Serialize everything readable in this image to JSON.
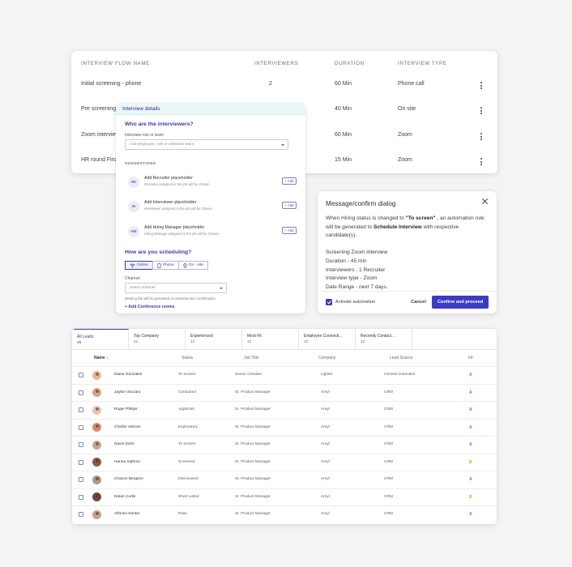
{
  "flow_table": {
    "headers": {
      "name": "INTERVIEW FLOW NAME",
      "interviewers": "INTERVIEWERS",
      "duration": "DURATION",
      "type": "INTERVIEW TYPE"
    },
    "rows": [
      {
        "name": "Initial screening - phone",
        "interviewers": "2",
        "duration": "60 Min",
        "type": "Phone call"
      },
      {
        "name": "Pre screening",
        "interviewers": "",
        "duration": "40 Min",
        "type": "On site"
      },
      {
        "name": "Zoom interview",
        "interviewers": "",
        "duration": "60 Min",
        "type": "Zoom"
      },
      {
        "name": "HR round Final",
        "interviewers": "",
        "duration": "15 Min",
        "type": "Zoom"
      }
    ]
  },
  "interview_details": {
    "header": "Interview details",
    "question_who": "Who are the interviewers?",
    "role_label": "Interview role or team",
    "role_placeholder": "Add employee, role or interview team",
    "suggestions_label": "SUGGESTIONS",
    "add_label": "+ Add",
    "suggestions": [
      {
        "initials": "RE",
        "title": "Add Recruiter placeholder",
        "desc": "Recruiter assigned in the job will be chosen"
      },
      {
        "initials": "IN",
        "title": "Add Interviewer placeholder",
        "desc": "Interviewer assigned in the job will be chosen"
      },
      {
        "initials": "HM",
        "title": "Add Hiring Manager placeholder",
        "desc": "Hiring Manager assigned in the job will be chosen"
      }
    ],
    "question_how": "How are you scheduling?",
    "modes": {
      "online": "Online",
      "phone": "Phone",
      "onsite": "On - site"
    },
    "channel_label": "Channel",
    "channel_placeholder": "Select channel",
    "meeting_note": "Meeting link will be generated on interview time confirmation.",
    "conference_link": "+ Add Conference rooms"
  },
  "dialog": {
    "title": "Message/confirm dialog",
    "body_prefix": "When Hiring status is changed to ",
    "status_value": "\"To screen\"",
    "body_middle": " , an automation rule will be generated to ",
    "action_value": "Schedule Interview",
    "body_suffix": " with respective candidate(s).",
    "details": [
      "Screening Zoom interview",
      "Duration - 45 min",
      "Interviewers : 1 Recruiter",
      "Interview type - Zoom",
      "Date Range - next 7 days."
    ],
    "checkbox_label": "Activate automation",
    "cancel_label": "Cancel",
    "confirm_label": "Confirm and proceed"
  },
  "leads": {
    "tabs": [
      {
        "label": "All Leads",
        "count": "25"
      },
      {
        "label": "Top Company",
        "count": "12"
      },
      {
        "label": "Experienced",
        "count": "12"
      },
      {
        "label": "Most Fit",
        "count": "12"
      },
      {
        "label": "Employee Connecti...",
        "count": "12"
      },
      {
        "label": "Recently Contact...",
        "count": "12"
      }
    ],
    "headers": {
      "name": "Name ↓",
      "status": "Status",
      "job": "Job Title",
      "company": "Company",
      "source": "Lead Source",
      "fit": "Fit"
    },
    "rows": [
      {
        "name": "Diane Gonzales",
        "status": "To Screen",
        "job": "Senior Creative",
        "company": "Lighter",
        "source": "Chrome Extention",
        "fit": "A"
      },
      {
        "name": "Jaylon Vaccaro",
        "status": "Contacted",
        "job": "Sr. Product Manager",
        "company": "Amyl",
        "source": "CRM",
        "fit": "A"
      },
      {
        "name": "Roger Philips",
        "status": "Applicant",
        "job": "Sr. Product Manager",
        "company": "Amyl",
        "source": "CRM",
        "fit": "A"
      },
      {
        "name": "Charlie Vetrovs",
        "status": "Exploratory",
        "job": "Sr. Product Manager",
        "company": "Amyl",
        "source": "CRM",
        "fit": "A"
      },
      {
        "name": "Davis Dorin",
        "status": "To Screen",
        "job": "Sr. Product Manager",
        "company": "Amyl",
        "source": "CRM",
        "fit": "A"
      },
      {
        "name": "Hanna Siphron",
        "status": "Screened",
        "job": "Sr. Product Manager",
        "company": "Amyl",
        "source": "CRM",
        "fit": "B"
      },
      {
        "name": "Chance Bergson",
        "status": "Interviewed",
        "job": "Sr. Product Manager",
        "company": "Amyl",
        "source": "CRM",
        "fit": "A"
      },
      {
        "name": "Nolan Curtis",
        "status": "Short Listed",
        "job": "Sr. Product Manager",
        "company": "Amyl",
        "source": "CRM",
        "fit": "B"
      },
      {
        "name": "Alfonso Kenter",
        "status": "Pass",
        "job": "Sr. Product Manager",
        "company": "Amyl",
        "source": "CRM",
        "fit": "A"
      }
    ]
  },
  "colors": {
    "accent": "#3b3bc4",
    "fit_a": "#2fa36b",
    "fit_b": "#e0a02a"
  }
}
